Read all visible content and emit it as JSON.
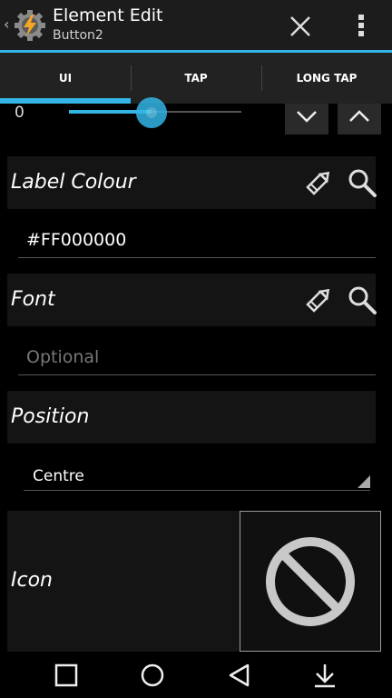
{
  "actionbar": {
    "back_glyph": "‹",
    "app_icon": "gear-lightning-icon",
    "title": "Element Edit",
    "subtitle": "Button2",
    "close_icon": "close-icon",
    "more_icon": "more-vert-icon"
  },
  "tabs": [
    {
      "label": "UI",
      "selected": true
    },
    {
      "label": "TAP",
      "selected": false
    },
    {
      "label": "LONG TAP",
      "selected": false
    }
  ],
  "slider": {
    "value_text": "0",
    "level": 0.48
  },
  "label_colour": {
    "label": "Label Colour",
    "value": "#FF000000"
  },
  "font": {
    "label": "Font",
    "placeholder": "Optional"
  },
  "position": {
    "label": "Position",
    "selected": "Centre"
  },
  "icon": {
    "label": "Icon",
    "preview_icon": "no-symbol-icon"
  },
  "colors": {
    "accent": "#33b5e5",
    "background": "#000000",
    "section": "#141414"
  }
}
